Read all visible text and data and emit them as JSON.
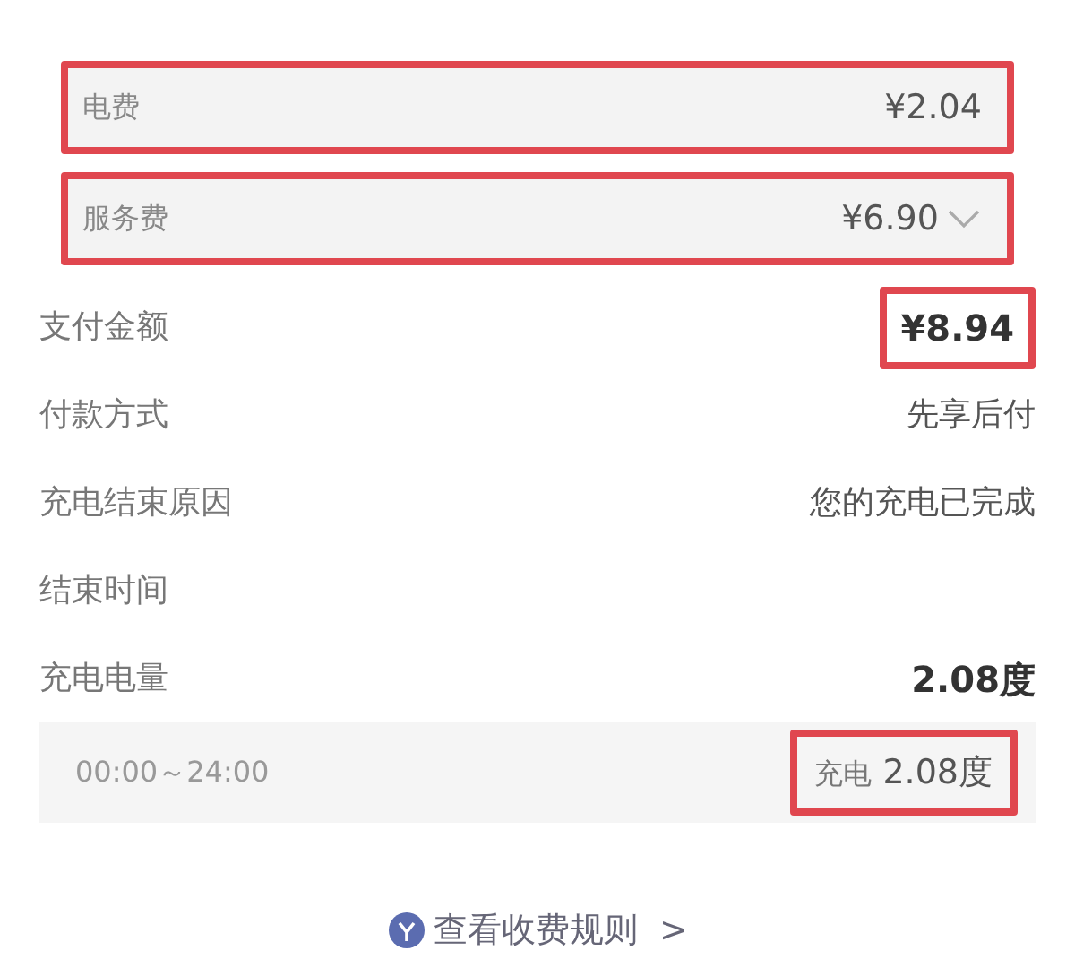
{
  "fees": [
    {
      "kind": "plain",
      "label": "电费",
      "value": "¥2.04",
      "highlighted": true
    },
    {
      "kind": "dropdown",
      "label": "服务费",
      "value": "¥6.90",
      "highlighted": true
    }
  ],
  "details": [
    {
      "label": "支付金额",
      "value": "¥8.94",
      "bold": true,
      "highlighted": true
    },
    {
      "label": "付款方式",
      "value": "先享后付",
      "bold": false,
      "highlighted": false
    },
    {
      "label": "充电结束原因",
      "value": "您的充电已完成",
      "bold": false,
      "highlighted": false
    },
    {
      "label": "结束时间"
    },
    {
      "label": "充电电量",
      "value": "2.08度",
      "bold": true,
      "highlighted": false
    }
  ],
  "period": {
    "time": "00:00～24:00",
    "label": "充电",
    "amount": "2.08度",
    "highlighted": true
  },
  "rules_link": {
    "text": "查看收费规则",
    "arrow": ">"
  }
}
